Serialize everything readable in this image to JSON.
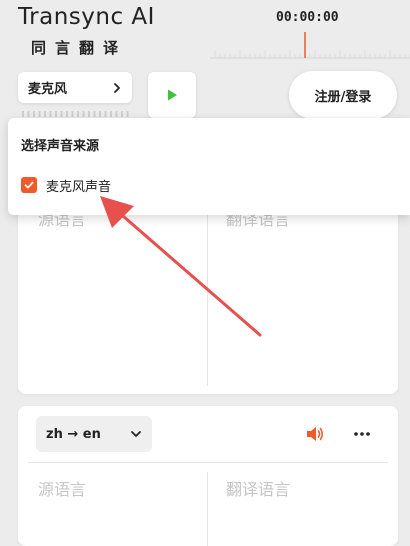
{
  "header": {
    "brand_title": "Transync AI",
    "brand_subtitle": "同言翻译",
    "timer": "00:00:00"
  },
  "controls": {
    "source_select_label": "麦克风",
    "login_label": "注册/登录"
  },
  "panel1": {
    "source_label": "源语言",
    "target_label": "翻译语言"
  },
  "panel2": {
    "lang_pair_from": "zh",
    "lang_pair_arrow": "→",
    "lang_pair_to": "en",
    "source_label": "源语言",
    "target_label": "翻译语言"
  },
  "popup": {
    "title": "选择声音来源",
    "option_label": "麦克风声音",
    "option_checked": true
  },
  "colors": {
    "accent": "#f05a28",
    "play": "#3cc43c",
    "annotation_arrow": "#e8504d"
  },
  "icons": [
    "chevron-right-icon",
    "play-icon",
    "chevron-down-icon",
    "speaker-icon",
    "more-icon",
    "check-icon"
  ]
}
